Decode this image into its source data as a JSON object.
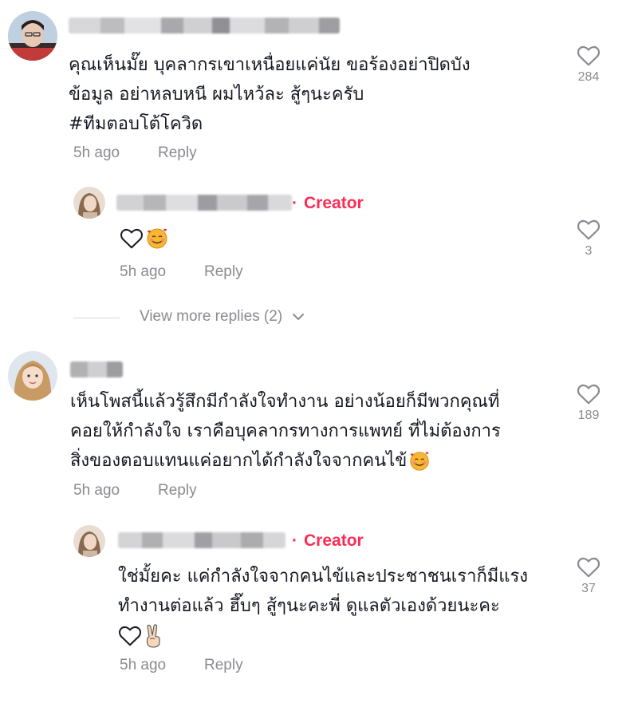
{
  "comments": [
    {
      "text_lines": [
        "คุณเห็นมั๊ย บุคลากรเขาเหนื่อยแค่นัย ขอร้องอย่าปิดบัง",
        "ข้อมูล อย่าหลบหนี ผมไหว้ละ สู้ๆนะครับ",
        "#ทีมตอบโต้โควิด"
      ],
      "time": "5h ago",
      "reply_label": "Reply",
      "likes": "284",
      "reply": {
        "badge": "Creator",
        "likes": "3",
        "time": "5h ago",
        "reply_label": "Reply"
      },
      "view_more": "View more replies (2)"
    },
    {
      "text_lines": [
        "เห็นโพสนี้แล้วรู้สึกมีกำลังใจทำงาน อย่างน้อยก็มีพวกคุณที่",
        "คอยให้กำลังใจ เราคือบุคลากรทางการแพทย์ ที่ไม่ต้องการ",
        "สิ่งของตอบแทนแค่อยากได้กำลังใจจากคนไข้"
      ],
      "time": "5h ago",
      "reply_label": "Reply",
      "likes": "189",
      "reply": {
        "badge": "Creator",
        "text_lines": [
          "ใช่มั้ยคะ แค่กำลังใจจากคนไข้และประชาชนเราก็มีแรง",
          "ทำงานต่อแล้ว ฮึ๊บๆ สู้ๆนะคะพี่ ดูแลตัวเองด้วยนะคะ"
        ],
        "likes": "37",
        "time": "5h ago",
        "reply_label": "Reply"
      }
    }
  ],
  "icons": {
    "like": "heart-outline-icon",
    "emoji_smile_hearts": "smiling-face-with-hearts-icon",
    "emoji_heart": "white-heart-icon",
    "emoji_victory": "victory-hand-icon",
    "chevron": "chevron-down-icon"
  },
  "colors": {
    "creator_badge": "#FE2C55",
    "meta_text": "#8a8b91",
    "body_text": "#161823"
  }
}
